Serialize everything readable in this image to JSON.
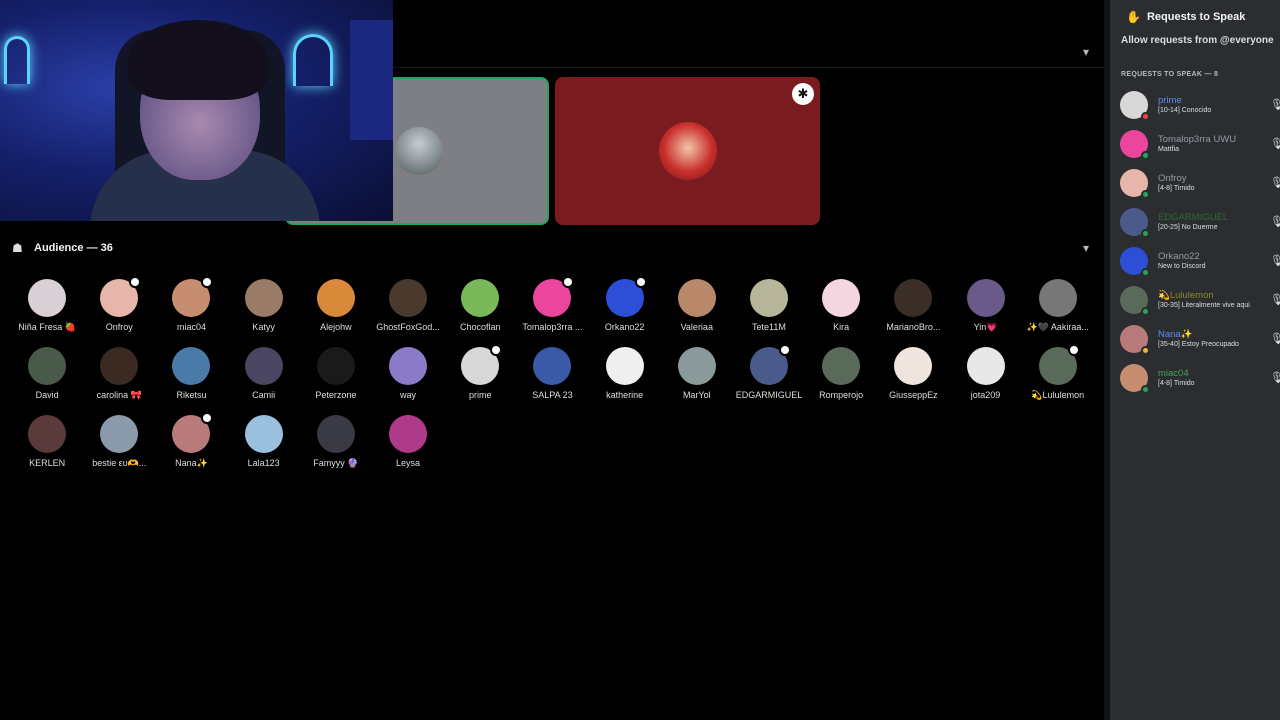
{
  "stage": {
    "collapse_icon": "chevron-down-icon",
    "speakers": [
      {
        "name": "",
        "speaking": true
      },
      {
        "name": "",
        "moderator": true
      }
    ]
  },
  "audience": {
    "title": "Audience — 36",
    "icon": "audience-icon",
    "members": [
      {
        "name": "Niña Fresa 🍓",
        "color": "#d8d0d4",
        "mod": false
      },
      {
        "name": "Onfroy",
        "color": "#e7b6ab",
        "mod": true
      },
      {
        "name": "miac04",
        "color": "#c78d70",
        "mod": true
      },
      {
        "name": "Katyy",
        "color": "#9a7b68",
        "mod": false
      },
      {
        "name": "Alejohw",
        "color": "#d88a3a",
        "mod": false
      },
      {
        "name": "GhostFoxGod...",
        "color": "#4a3a2e",
        "mod": false
      },
      {
        "name": "Chocoflan",
        "color": "#7ab95a",
        "mod": false
      },
      {
        "name": "Tomalop3rra ...",
        "color": "#eb459e",
        "mod": true
      },
      {
        "name": "Orkano22",
        "color": "#2d4fd8",
        "mod": true
      },
      {
        "name": "Valeriaa",
        "color": "#b9876a",
        "mod": false
      },
      {
        "name": "Tete11M",
        "color": "#b7b59a",
        "mod": false
      },
      {
        "name": "Kira",
        "color": "#f4d6e0",
        "mod": false
      },
      {
        "name": "MarianoBro...",
        "color": "#3a2e26",
        "mod": false
      },
      {
        "name": "Yin💗",
        "color": "#6a5a8a",
        "mod": false
      },
      {
        "name": "✨🖤 Aakiraa...",
        "color": "#777777",
        "mod": false
      },
      {
        "name": "David",
        "color": "#4a5a4a",
        "mod": false
      },
      {
        "name": "carolina 🎀",
        "color": "#3a2a22",
        "mod": false
      },
      {
        "name": "Riketsu",
        "color": "#4a7aa8",
        "mod": false
      },
      {
        "name": "Camii",
        "color": "#4a4560",
        "mod": false
      },
      {
        "name": "Peterzone",
        "color": "#1a1a1a",
        "mod": false
      },
      {
        "name": "way",
        "color": "#8a7ac8",
        "mod": false
      },
      {
        "name": "prime",
        "color": "#d8d8d8",
        "mod": true
      },
      {
        "name": "SALPA 23",
        "color": "#3a5aa8",
        "mod": false
      },
      {
        "name": "katherine",
        "color": "#efefef",
        "mod": false
      },
      {
        "name": "MarYol",
        "color": "#8a9a9a",
        "mod": false
      },
      {
        "name": "EDGARMIGUEL",
        "color": "#4a5a8a",
        "mod": true
      },
      {
        "name": "Romperojo",
        "color": "#5a6a5a",
        "mod": false
      },
      {
        "name": "GiusseppEz",
        "color": "#f0e4de",
        "mod": false
      },
      {
        "name": "jota209",
        "color": "#e8e8e8",
        "mod": false
      },
      {
        "name": "💫Lululemon",
        "color": "#5a6a5a",
        "mod": true
      },
      {
        "name": "KERLEN",
        "color": "#5a3a3a",
        "mod": false
      },
      {
        "name": "bestie ευ🫶...",
        "color": "#8a9aaa",
        "mod": false
      },
      {
        "name": "Nana✨",
        "color": "#b87a7a",
        "mod": true
      },
      {
        "name": "Lala123",
        "color": "#9ac0e0",
        "mod": false
      },
      {
        "name": "Famyyy 🔮",
        "color": "#3a3a44",
        "mod": false
      },
      {
        "name": "Leysa",
        "color": "#b03a8a",
        "mod": false
      }
    ]
  },
  "panel": {
    "title": "Requests to Speak",
    "title_icon": "raise-hand-icon",
    "allow_text": "Allow requests from @everyone",
    "section_label": "REQUESTS TO SPEAK — 8",
    "requests": [
      {
        "name": "prime",
        "status": "[10-14] Conocido",
        "name_color": "#5b8def",
        "avatar_color": "#d8d8d8",
        "status_color": "#f23f43"
      },
      {
        "name": "Tomalop3rra UWU",
        "status": "Mattfia",
        "name_color": "#949ba4",
        "avatar_color": "#eb459e",
        "status_color": "#23a55a"
      },
      {
        "name": "Onfroy",
        "status": "[4-8] Timido",
        "name_color": "#949ba4",
        "avatar_color": "#e7b6ab",
        "status_color": "#23a55a"
      },
      {
        "name": "EDGARMIGUEL",
        "status": "[20-25] No Duerme",
        "name_color": "#2e6b2e",
        "avatar_color": "#4a5a8a",
        "status_color": "#23a55a"
      },
      {
        "name": "Orkano22",
        "status": "New to Discord",
        "name_color": "#949ba4",
        "avatar_color": "#2d4fd8",
        "status_color": "#23a55a"
      },
      {
        "name": "💫Lululemon",
        "status": "[30-35] Literalmente vive aqui",
        "name_color": "#8a8a2a",
        "avatar_color": "#5a6a5a",
        "status_color": "#23a55a"
      },
      {
        "name": "Nana✨",
        "status": "[35-40] Estoy Preocupado",
        "name_color": "#5b8def",
        "avatar_color": "#b87a7a",
        "status_color": "#f0b232"
      },
      {
        "name": "miac04",
        "status": "[4-8] Timido",
        "name_color": "#3ba55c",
        "avatar_color": "#c78d70",
        "status_color": "#23a55a"
      }
    ]
  }
}
